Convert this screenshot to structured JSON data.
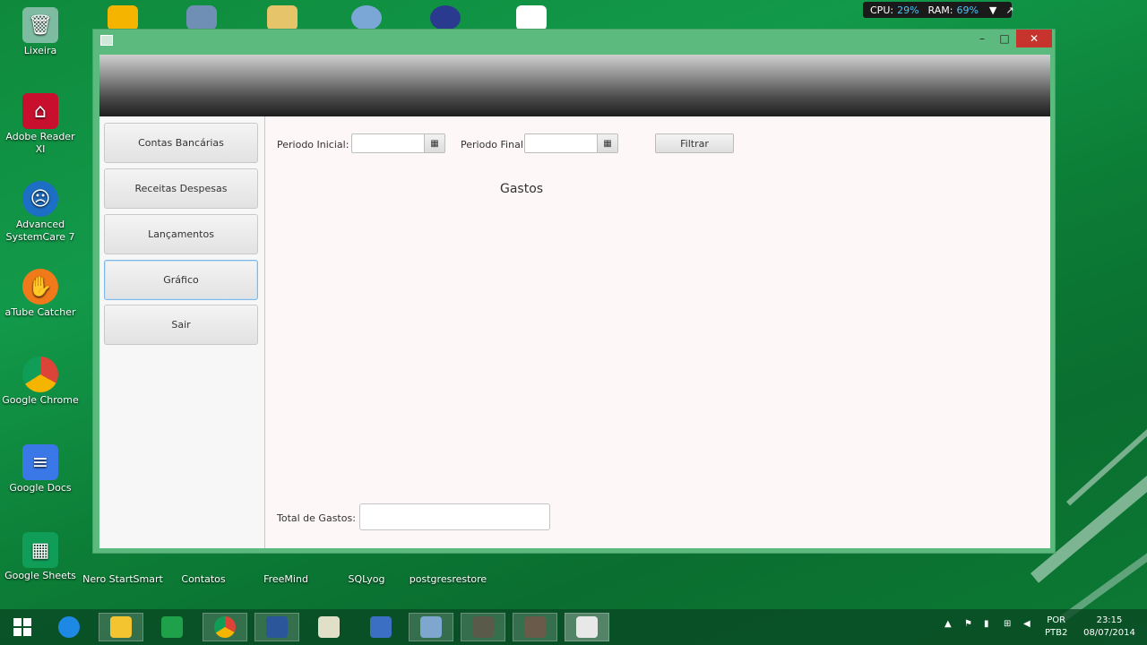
{
  "desktop": {
    "icons": [
      {
        "label": "Lixeira"
      },
      {
        "label": "Adobe Reader XI"
      },
      {
        "label": "Advanced SystemCare 7"
      },
      {
        "label": "aTube Catcher"
      },
      {
        "label": "Google Chrome"
      },
      {
        "label": "Google Docs"
      },
      {
        "label": "Google Sheets"
      },
      {
        "label": "Nero StartSmart"
      },
      {
        "label": "Contatos"
      },
      {
        "label": "FreeMind"
      },
      {
        "label": "SQLyog"
      },
      {
        "label": "postgresrestore"
      }
    ]
  },
  "meter": {
    "cpu_label": "CPU:",
    "cpu_value": "29%",
    "ram_label": "RAM:",
    "ram_value": "69%"
  },
  "window": {
    "min_glyph": "–",
    "max_glyph": "□",
    "close_glyph": "✕"
  },
  "sidebar": {
    "items": [
      {
        "label": "Contas Bancárias"
      },
      {
        "label": "Receitas Despesas"
      },
      {
        "label": "Lançamentos"
      },
      {
        "label": "Gráfico"
      },
      {
        "label": "Sair"
      }
    ]
  },
  "filters": {
    "start_label": "Periodo Inicial:",
    "start_value": "",
    "end_label": "Periodo Final:",
    "end_value": "",
    "filter_button": "Filtrar",
    "calendar_glyph": "▦"
  },
  "chart": {
    "title": "Gastos"
  },
  "total": {
    "label": "Total de Gastos:",
    "value": ""
  },
  "tray": {
    "lang": "POR",
    "layout": "PTB2",
    "time": "23:15",
    "date": "08/07/2014"
  },
  "colors": {
    "desktop_green": "#0f8a3c",
    "window_frame": "#5cba7f",
    "close_red": "#c7342d"
  }
}
